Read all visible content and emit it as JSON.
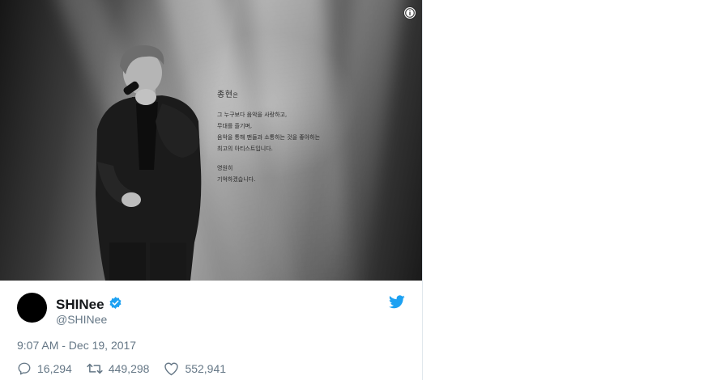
{
  "photo": {
    "heading": "종현",
    "heading_suffix": "은",
    "lines": [
      "그 누구보다 음악을 사랑하고,",
      "무대를 즐기며,",
      "음악을 통해 팬들과 소통하는 것을 좋아하는",
      "최고의 아티스트입니다."
    ],
    "closing": [
      "영원히",
      "기억하겠습니다."
    ]
  },
  "author": {
    "display_name": "SHINee",
    "username": "@SHINee",
    "verified": true,
    "avatar_color": "#000000"
  },
  "timestamp": "9:07 AM - Dec 19, 2017",
  "actions": {
    "replies": "16,294",
    "retweets": "449,298",
    "likes": "552,941"
  },
  "icons": {
    "info": "info-icon",
    "verified": "verified-badge-icon",
    "brand": "twitter-bird-icon",
    "reply": "reply-icon",
    "retweet": "retweet-icon",
    "like": "heart-icon"
  },
  "colors": {
    "accent": "#1da1f2",
    "text": "#14171a",
    "secondary": "#657786"
  }
}
